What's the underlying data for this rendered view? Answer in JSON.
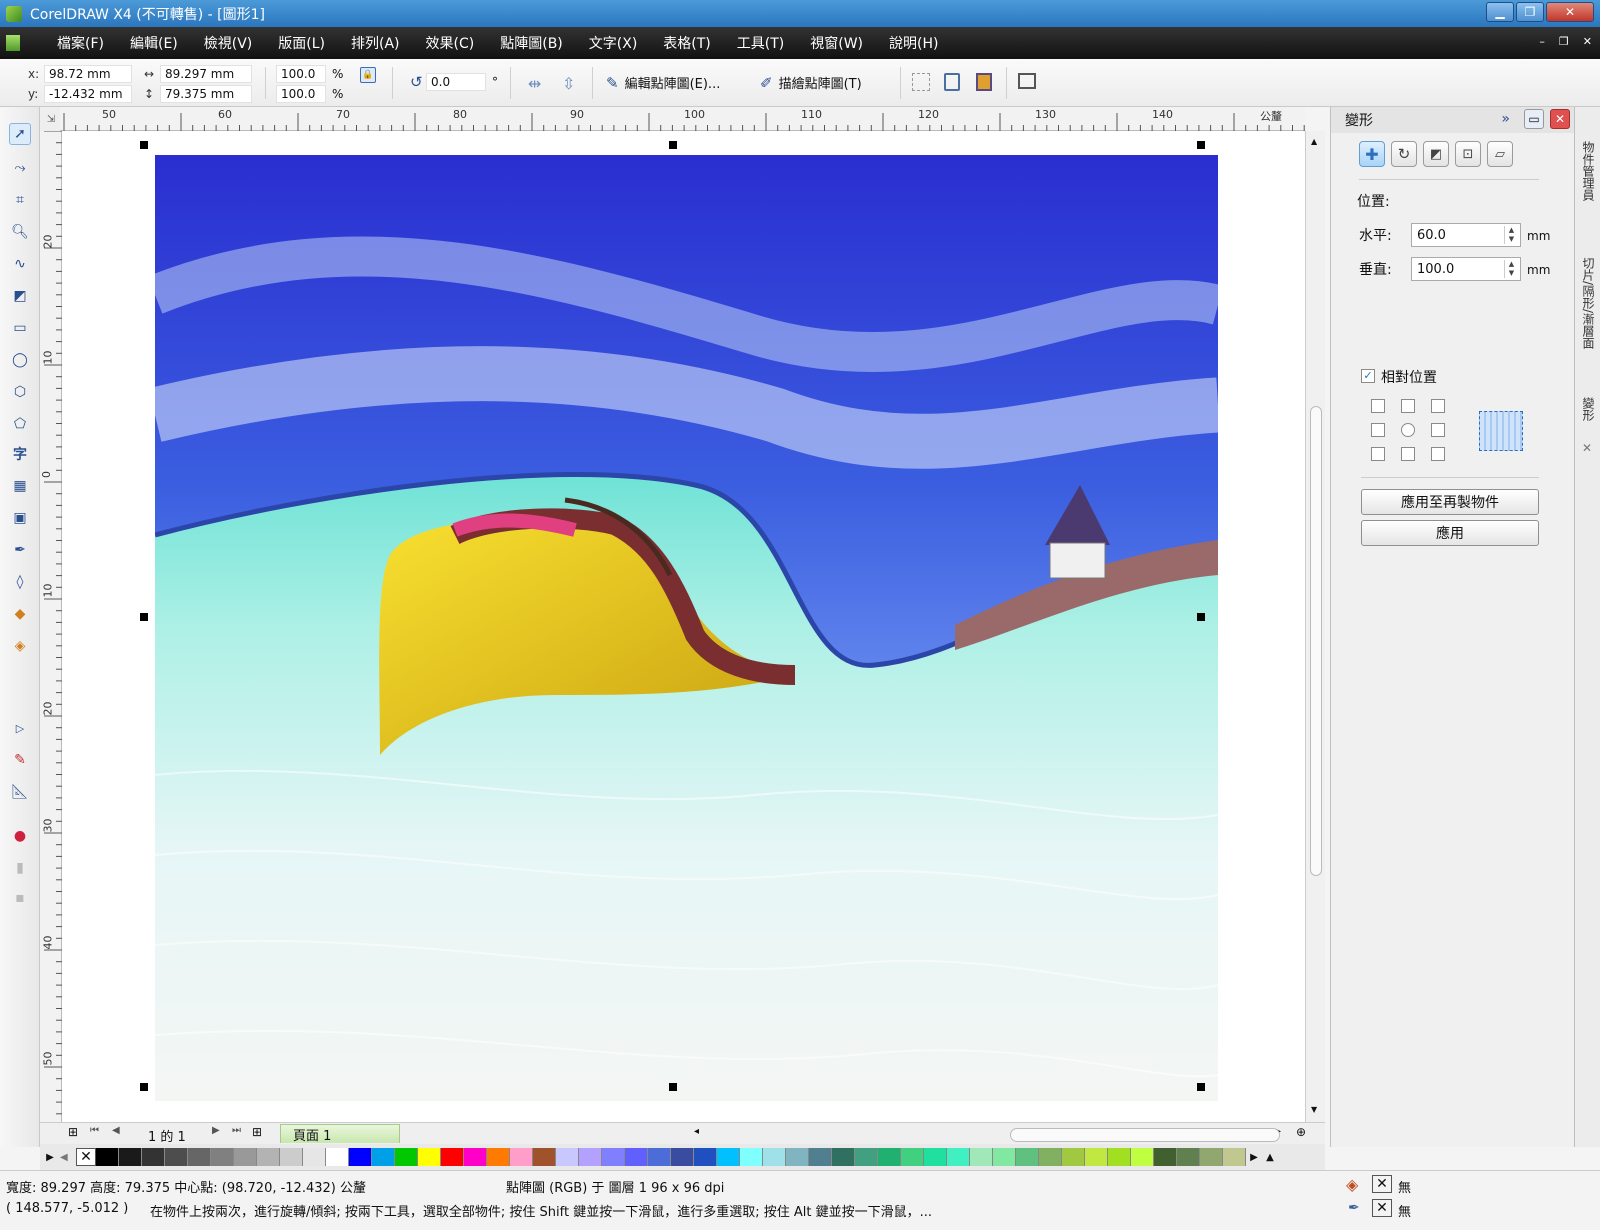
{
  "window": {
    "title": "CorelDRAW X4 (不可轉售) - [圖形1]",
    "min": "▁",
    "restore": "❐",
    "close": "✕"
  },
  "menu": [
    "檔案(F)",
    "編輯(E)",
    "檢視(V)",
    "版面(L)",
    "排列(A)",
    "效果(C)",
    "點陣圖(B)",
    "文字(X)",
    "表格(T)",
    "工具(T)",
    "視窗(W)",
    "說明(H)"
  ],
  "mdi_controls": {
    "min": "–",
    "restore": "❐",
    "close": "✕"
  },
  "propbar": {
    "x_label": "x:",
    "x": "98.72 mm",
    "y_label": "y:",
    "y": "-12.432 mm",
    "w": "89.297 mm",
    "h": "79.375 mm",
    "scale_w": "100.0",
    "scale_h": "100.0",
    "pct": "%",
    "rotation": "0.0",
    "deg": "°",
    "edit_bitmap": "編輯點陣圖(E)...",
    "trace_bitmap": "描繪點陣圖(T)"
  },
  "ruler": {
    "top": [
      "50",
      "60",
      "70",
      "80",
      "90",
      "100",
      "110",
      "120",
      "130",
      "140"
    ],
    "left": [
      "20",
      "10",
      "0",
      "10",
      "20",
      "30",
      "40",
      "50"
    ],
    "corner": "⇲",
    "unit": "公釐"
  },
  "pagebar": {
    "page_count": "1 的 1",
    "page_tab": "頁面 1"
  },
  "palette_colors": [
    "#000000",
    "#1a1a1a",
    "#333333",
    "#4d4d4d",
    "#666666",
    "#808080",
    "#999999",
    "#b3b3b3",
    "#cccccc",
    "#e6e6e6",
    "#ffffff",
    "#0000ff",
    "#00a0e9",
    "#00c800",
    "#ffff00",
    "#ff0000",
    "#ff00c8",
    "#ff7a00",
    "#ff9ec8",
    "#a0522d",
    "#c8c8ff",
    "#b4a0ff",
    "#8080ff",
    "#6060ff",
    "#4c6cd8",
    "#3a4ca0",
    "#2050c0",
    "#00c0ff",
    "#80ffff",
    "#a0e0e8",
    "#80b4c0",
    "#508090",
    "#307060",
    "#40a080",
    "#20b070",
    "#40d080",
    "#20e0a0",
    "#40f0c0",
    "#a0e8b8",
    "#80e8a0",
    "#60c080",
    "#80b060",
    "#a0c840",
    "#c0e840",
    "#a0e020",
    "#c0ff40",
    "#406030",
    "#608050",
    "#90a870",
    "#c0c890"
  ],
  "status": {
    "dims": "寬度: 89.297 高度: 79.375 中心點: (98.720, -12.432) 公釐",
    "object": "點陣圖 (RGB) 于 圖層 1 96 x 96 dpi",
    "coords": "( 148.577, -5.012 )",
    "hint": "在物件上按兩次，進行旋轉/傾斜; 按兩下工具，選取全部物件; 按住 Shift 鍵並按一下滑鼠，進行多重選取; 按住 Alt 鍵並按一下滑鼠，...",
    "fill_none": "無",
    "outline_none": "無"
  },
  "docker": {
    "title": "變形",
    "position_label": "位置:",
    "h_label": "水平:",
    "h_value": "60.0",
    "v_label": "垂直:",
    "v_value": "100.0",
    "unit": "mm",
    "relative": "相對位置",
    "apply_dup": "應用至再製物件",
    "apply": "應用"
  },
  "docker_tabs": [
    "物件管理員",
    "切片/隔形/漸層面",
    "變形"
  ],
  "colors": {
    "title_blue": "#2b76be",
    "menubar": "#1a1a1a",
    "selected_tab": "#c8e7ae",
    "accent": "#5f9fd5"
  }
}
